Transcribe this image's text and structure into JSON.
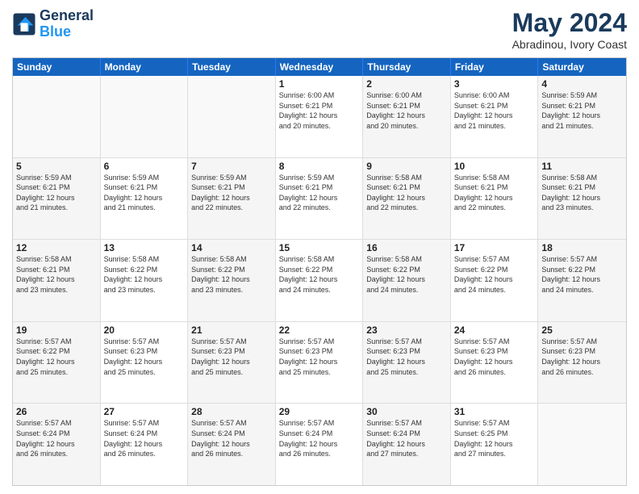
{
  "logo": {
    "line1": "General",
    "line2": "Blue"
  },
  "title": "May 2024",
  "subtitle": "Abradinou, Ivory Coast",
  "header_days": [
    "Sunday",
    "Monday",
    "Tuesday",
    "Wednesday",
    "Thursday",
    "Friday",
    "Saturday"
  ],
  "weeks": [
    [
      {
        "day": "",
        "info": ""
      },
      {
        "day": "",
        "info": ""
      },
      {
        "day": "",
        "info": ""
      },
      {
        "day": "1",
        "info": "Sunrise: 6:00 AM\nSunset: 6:21 PM\nDaylight: 12 hours\nand 20 minutes."
      },
      {
        "day": "2",
        "info": "Sunrise: 6:00 AM\nSunset: 6:21 PM\nDaylight: 12 hours\nand 20 minutes."
      },
      {
        "day": "3",
        "info": "Sunrise: 6:00 AM\nSunset: 6:21 PM\nDaylight: 12 hours\nand 21 minutes."
      },
      {
        "day": "4",
        "info": "Sunrise: 5:59 AM\nSunset: 6:21 PM\nDaylight: 12 hours\nand 21 minutes."
      }
    ],
    [
      {
        "day": "5",
        "info": "Sunrise: 5:59 AM\nSunset: 6:21 PM\nDaylight: 12 hours\nand 21 minutes."
      },
      {
        "day": "6",
        "info": "Sunrise: 5:59 AM\nSunset: 6:21 PM\nDaylight: 12 hours\nand 21 minutes."
      },
      {
        "day": "7",
        "info": "Sunrise: 5:59 AM\nSunset: 6:21 PM\nDaylight: 12 hours\nand 22 minutes."
      },
      {
        "day": "8",
        "info": "Sunrise: 5:59 AM\nSunset: 6:21 PM\nDaylight: 12 hours\nand 22 minutes."
      },
      {
        "day": "9",
        "info": "Sunrise: 5:58 AM\nSunset: 6:21 PM\nDaylight: 12 hours\nand 22 minutes."
      },
      {
        "day": "10",
        "info": "Sunrise: 5:58 AM\nSunset: 6:21 PM\nDaylight: 12 hours\nand 22 minutes."
      },
      {
        "day": "11",
        "info": "Sunrise: 5:58 AM\nSunset: 6:21 PM\nDaylight: 12 hours\nand 23 minutes."
      }
    ],
    [
      {
        "day": "12",
        "info": "Sunrise: 5:58 AM\nSunset: 6:21 PM\nDaylight: 12 hours\nand 23 minutes."
      },
      {
        "day": "13",
        "info": "Sunrise: 5:58 AM\nSunset: 6:22 PM\nDaylight: 12 hours\nand 23 minutes."
      },
      {
        "day": "14",
        "info": "Sunrise: 5:58 AM\nSunset: 6:22 PM\nDaylight: 12 hours\nand 23 minutes."
      },
      {
        "day": "15",
        "info": "Sunrise: 5:58 AM\nSunset: 6:22 PM\nDaylight: 12 hours\nand 24 minutes."
      },
      {
        "day": "16",
        "info": "Sunrise: 5:58 AM\nSunset: 6:22 PM\nDaylight: 12 hours\nand 24 minutes."
      },
      {
        "day": "17",
        "info": "Sunrise: 5:57 AM\nSunset: 6:22 PM\nDaylight: 12 hours\nand 24 minutes."
      },
      {
        "day": "18",
        "info": "Sunrise: 5:57 AM\nSunset: 6:22 PM\nDaylight: 12 hours\nand 24 minutes."
      }
    ],
    [
      {
        "day": "19",
        "info": "Sunrise: 5:57 AM\nSunset: 6:22 PM\nDaylight: 12 hours\nand 25 minutes."
      },
      {
        "day": "20",
        "info": "Sunrise: 5:57 AM\nSunset: 6:23 PM\nDaylight: 12 hours\nand 25 minutes."
      },
      {
        "day": "21",
        "info": "Sunrise: 5:57 AM\nSunset: 6:23 PM\nDaylight: 12 hours\nand 25 minutes."
      },
      {
        "day": "22",
        "info": "Sunrise: 5:57 AM\nSunset: 6:23 PM\nDaylight: 12 hours\nand 25 minutes."
      },
      {
        "day": "23",
        "info": "Sunrise: 5:57 AM\nSunset: 6:23 PM\nDaylight: 12 hours\nand 25 minutes."
      },
      {
        "day": "24",
        "info": "Sunrise: 5:57 AM\nSunset: 6:23 PM\nDaylight: 12 hours\nand 26 minutes."
      },
      {
        "day": "25",
        "info": "Sunrise: 5:57 AM\nSunset: 6:23 PM\nDaylight: 12 hours\nand 26 minutes."
      }
    ],
    [
      {
        "day": "26",
        "info": "Sunrise: 5:57 AM\nSunset: 6:24 PM\nDaylight: 12 hours\nand 26 minutes."
      },
      {
        "day": "27",
        "info": "Sunrise: 5:57 AM\nSunset: 6:24 PM\nDaylight: 12 hours\nand 26 minutes."
      },
      {
        "day": "28",
        "info": "Sunrise: 5:57 AM\nSunset: 6:24 PM\nDaylight: 12 hours\nand 26 minutes."
      },
      {
        "day": "29",
        "info": "Sunrise: 5:57 AM\nSunset: 6:24 PM\nDaylight: 12 hours\nand 26 minutes."
      },
      {
        "day": "30",
        "info": "Sunrise: 5:57 AM\nSunset: 6:24 PM\nDaylight: 12 hours\nand 27 minutes."
      },
      {
        "day": "31",
        "info": "Sunrise: 5:57 AM\nSunset: 6:25 PM\nDaylight: 12 hours\nand 27 minutes."
      },
      {
        "day": "",
        "info": ""
      }
    ]
  ]
}
